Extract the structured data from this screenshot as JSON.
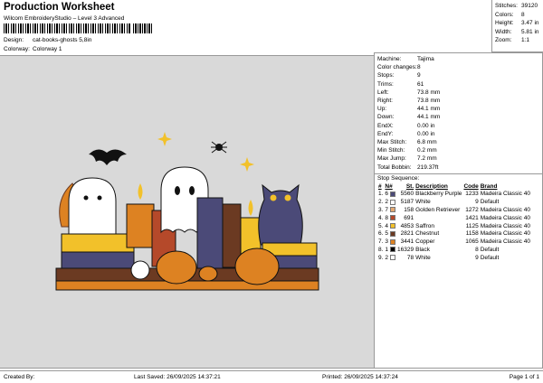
{
  "header": {
    "title": "Production Worksheet",
    "subtitle": "Wilcom EmbroideryStudio – Level 3 Advanced",
    "design_label": "Design:",
    "design_value": "cat-books-ghosts 5,8in",
    "colorway_label": "Colorway:",
    "colorway_value": "Colorway 1"
  },
  "stats": [
    {
      "label": "Stitches:",
      "value": "39120"
    },
    {
      "label": "Colors:",
      "value": "8"
    },
    {
      "label": "Height:",
      "value": "3.47 in"
    },
    {
      "label": "Width:",
      "value": "5.81 in"
    },
    {
      "label": "Zoom:",
      "value": "1:1"
    }
  ],
  "machine": [
    {
      "label": "Machine:",
      "value": "Tajima"
    },
    {
      "label": "Color changes:",
      "value": "8"
    },
    {
      "label": "Stops:",
      "value": "9"
    },
    {
      "label": "Trims:",
      "value": "61"
    },
    {
      "label": "Left:",
      "value": "73.8 mm"
    },
    {
      "label": "Right:",
      "value": "73.8 mm"
    },
    {
      "label": "Up:",
      "value": "44.1 mm"
    },
    {
      "label": "Down:",
      "value": "44.1 mm"
    },
    {
      "label": "EndX:",
      "value": "0.00 in"
    },
    {
      "label": "EndY:",
      "value": "0.00 in"
    },
    {
      "label": "Max Stitch:",
      "value": "6.8 mm"
    },
    {
      "label": "Min Stitch:",
      "value": "0.2 mm"
    },
    {
      "label": "Max Jump:",
      "value": "7.2 mm"
    },
    {
      "label": "Total Bobbin:",
      "value": "219.37ft"
    }
  ],
  "sequence": {
    "title": "Stop Sequence:",
    "headers": [
      "#",
      "N#",
      "St.",
      "Description",
      "Code",
      "Brand"
    ],
    "rows": [
      {
        "n": "1.",
        "c": "6",
        "color": "#4b4a78",
        "st": "5560",
        "desc": "Blackberry Purple",
        "code": "1233",
        "brand": "Madeira Classic 40"
      },
      {
        "n": "2.",
        "c": "2",
        "color": "#ffffff",
        "st": "5187",
        "desc": "White",
        "code": "9",
        "brand": "Default"
      },
      {
        "n": "3.",
        "c": "7",
        "color": "#e2a872",
        "st": "158",
        "desc": "Golden Retriever",
        "code": "1272",
        "brand": "Madeira Classic 40"
      },
      {
        "n": "4.",
        "c": "8",
        "color": "#b5492a",
        "st": "691",
        "desc": "",
        "code": "1421",
        "brand": "Madeira Classic 40"
      },
      {
        "n": "5.",
        "c": "4",
        "color": "#f2c12a",
        "st": "4853",
        "desc": "Saffron",
        "code": "1125",
        "brand": "Madeira Classic 40"
      },
      {
        "n": "6.",
        "c": "5",
        "color": "#6b3a22",
        "st": "2821",
        "desc": "Chestnut",
        "code": "1158",
        "brand": "Madeira Classic 40"
      },
      {
        "n": "7.",
        "c": "3",
        "color": "#dd8222",
        "st": "3441",
        "desc": "Copper",
        "code": "1065",
        "brand": "Madeira Classic 40"
      },
      {
        "n": "8.",
        "c": "1",
        "color": "#000000",
        "st": "16329",
        "desc": "Black",
        "code": "8",
        "brand": "Default"
      },
      {
        "n": "9.",
        "c": "2",
        "color": "#ffffff",
        "st": "78",
        "desc": "White",
        "code": "9",
        "brand": "Default"
      }
    ]
  },
  "footer": {
    "created": "Created By:",
    "saved": "Last Saved: 26/09/2025 14:37:21",
    "printed": "Printed: 26/09/2025 14:37:24",
    "page": "Page 1 of 1"
  }
}
